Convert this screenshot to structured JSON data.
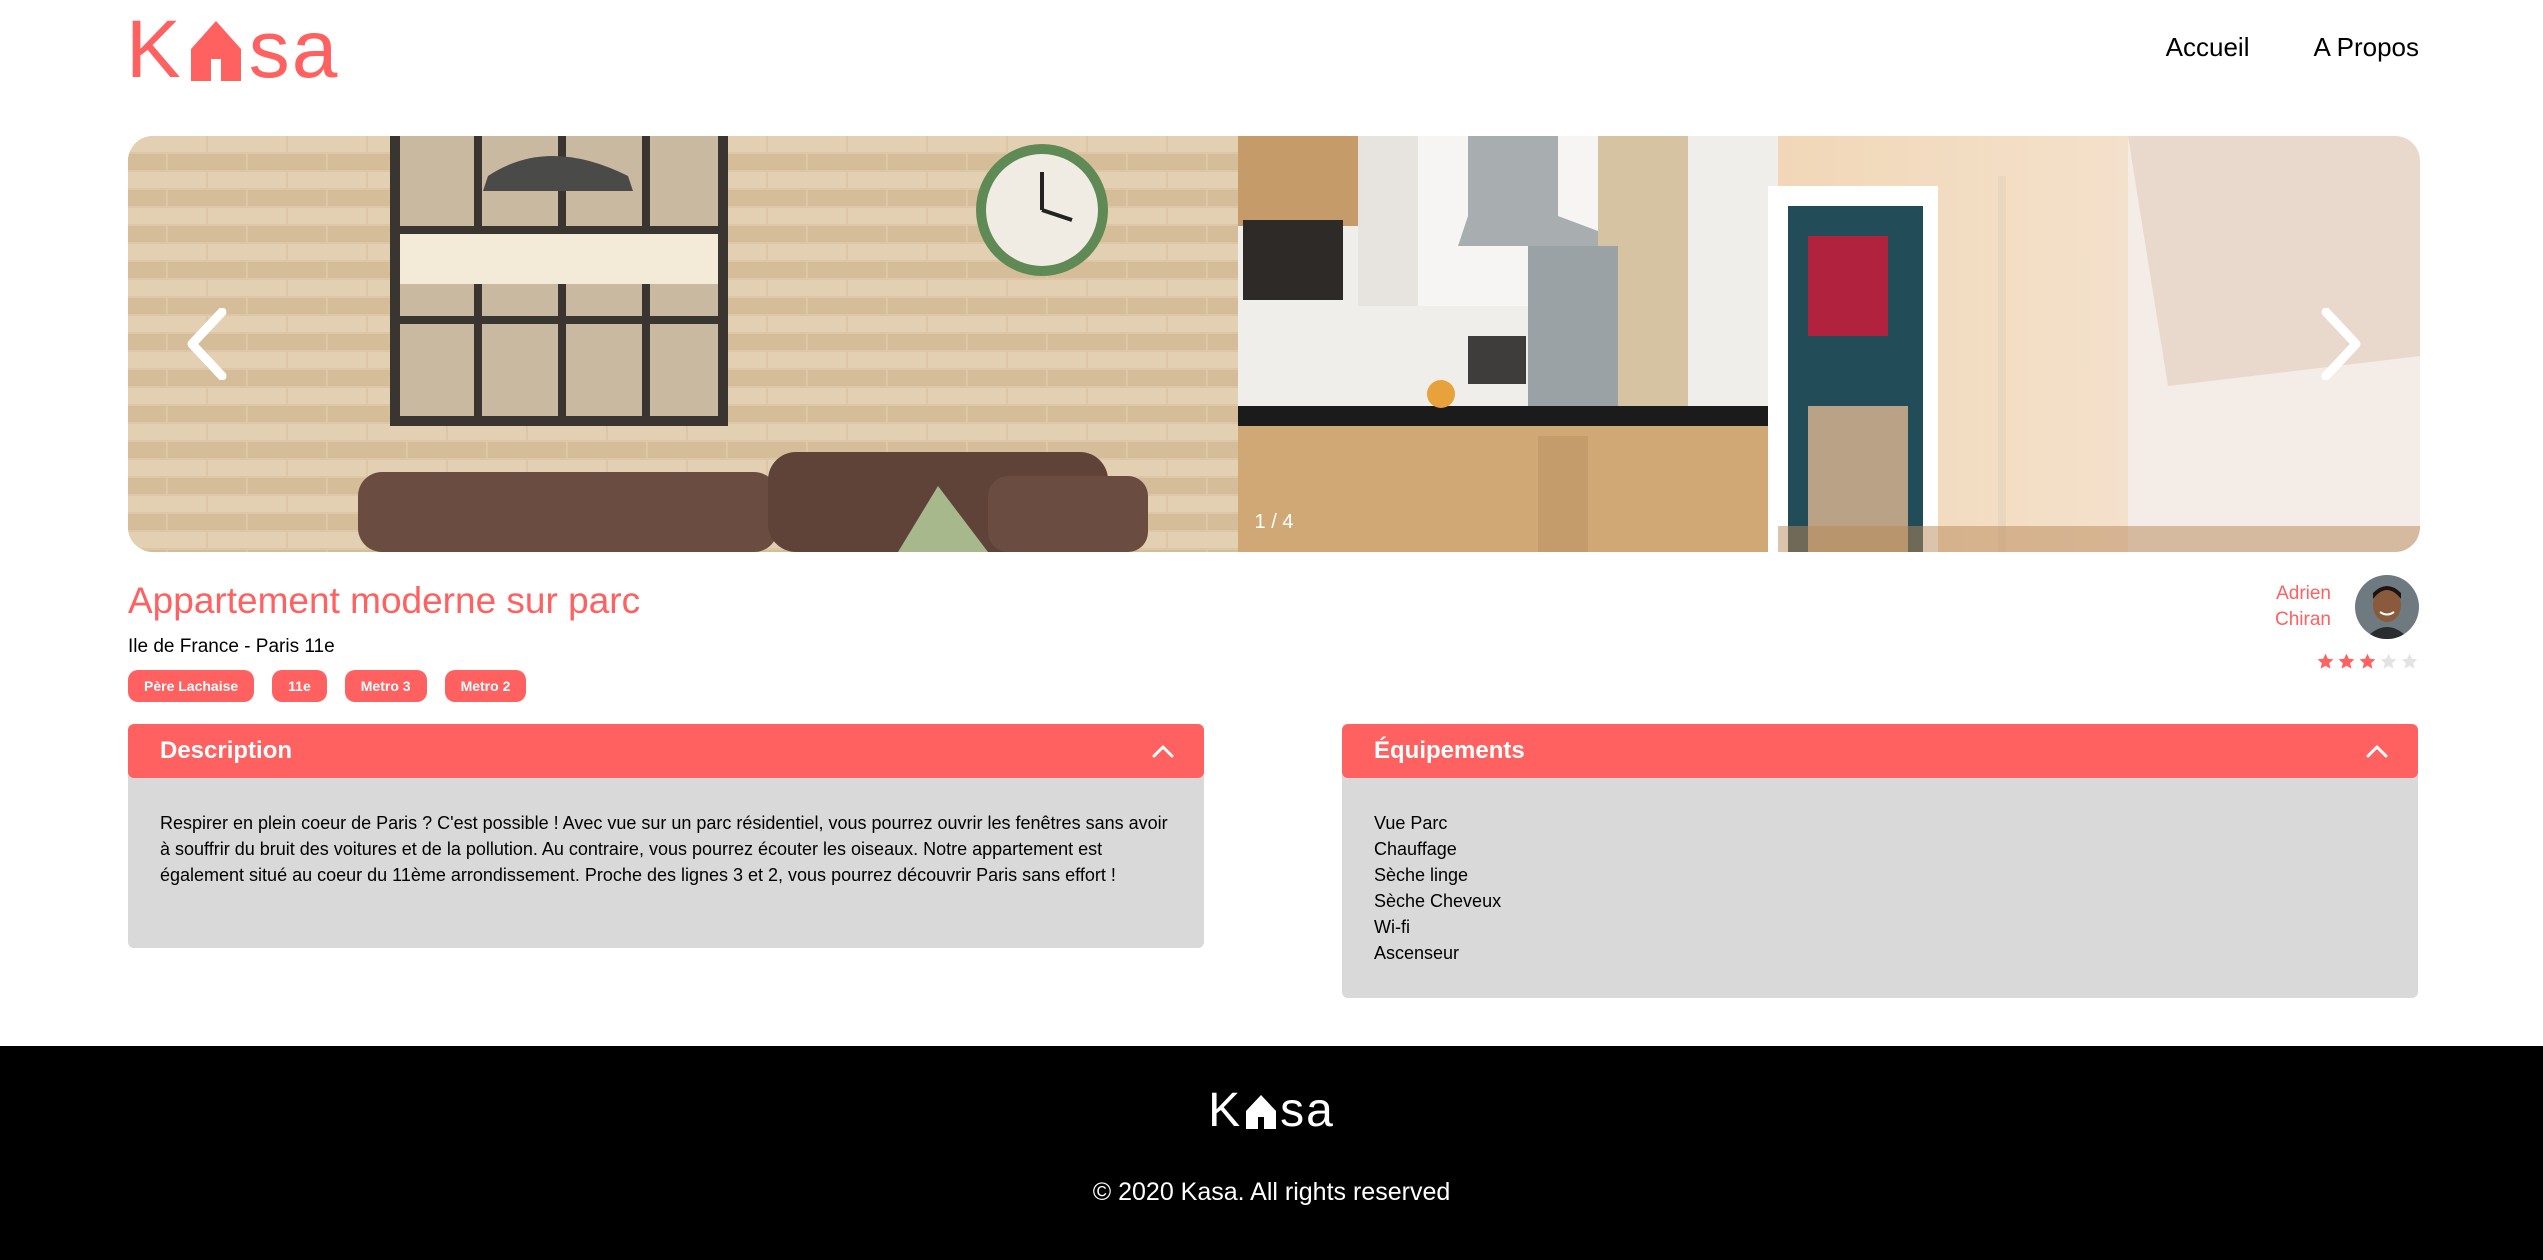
{
  "header": {
    "logo_left": "K",
    "logo_right": "sa",
    "nav": [
      {
        "label": "Accueil"
      },
      {
        "label": "A Propos"
      }
    ]
  },
  "carousel": {
    "counter": "1 / 4",
    "current": 1,
    "total": 4
  },
  "listing": {
    "title": "Appartement moderne sur parc",
    "location": "Ile de France - Paris 11e",
    "tags": [
      "Père Lachaise",
      "11e",
      "Metro 3",
      "Metro 2"
    ],
    "host": {
      "first_name": "Adrien",
      "last_name": "Chiran"
    },
    "rating": 3,
    "rating_max": 5
  },
  "description": {
    "label": "Description",
    "text": "Respirer en plein coeur de Paris ? C'est possible ! Avec vue sur un parc résidentiel, vous pourrez ouvrir les fenêtres sans avoir à souffrir du bruit des voitures et de la pollution. Au contraire, vous pourrez écouter les oiseaux. Notre appartement est également situé au coeur du 11ème arrondissement. Proche des lignes 3 et 2, vous pourrez découvrir Paris sans effort !"
  },
  "equipments": {
    "label": "Équipements",
    "items": [
      "Vue Parc",
      "Chauffage",
      "Sèche linge",
      "Sèche Cheveux",
      "Wi-fi",
      "Ascenseur"
    ]
  },
  "footer": {
    "logo_left": "K",
    "logo_right": "sa",
    "copyright": "© 2020 Kasa. All rights reserved"
  },
  "colors": {
    "primary": "#FF6060",
    "collapse_bg": "#D9D9D9",
    "footer_bg": "#000000"
  },
  "icons": [
    "kasa-logo-house-icon",
    "chevron-left-icon",
    "chevron-right-icon",
    "chevron-up-icon",
    "star-icon"
  ]
}
